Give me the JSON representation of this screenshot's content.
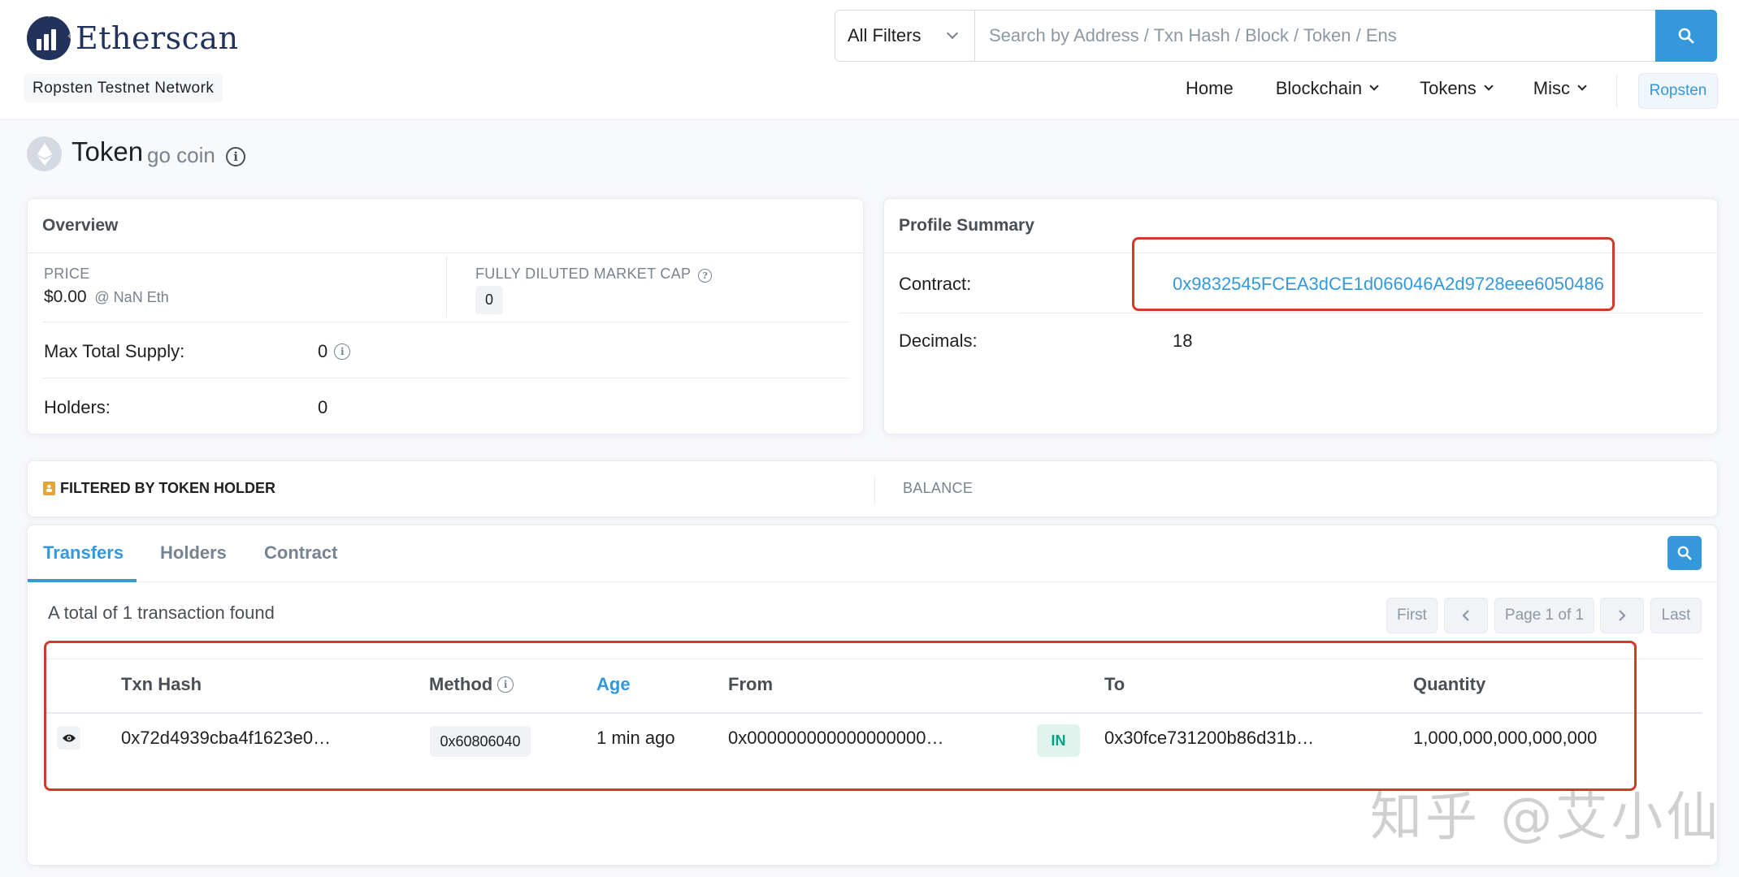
{
  "header": {
    "brand": "Etherscan",
    "network_badge": "Ropsten Testnet Network",
    "search": {
      "filter_label": "All Filters",
      "placeholder": "Search by Address / Txn Hash / Block / Token / Ens"
    },
    "nav": [
      "Home",
      "Blockchain",
      "Tokens",
      "Misc"
    ],
    "network_button": "Ropsten"
  },
  "page": {
    "title": "Token",
    "subtitle": "go coin"
  },
  "overview": {
    "header": "Overview",
    "price_label": "PRICE",
    "price_value": "$0.00",
    "price_eth": "@ NaN Eth",
    "market_cap_label": "FULLY DILUTED MARKET CAP",
    "market_cap_value": "0",
    "max_supply_label": "Max Total Supply:",
    "max_supply_value": "0",
    "holders_label": "Holders:",
    "holders_value": "0"
  },
  "profile": {
    "header": "Profile Summary",
    "contract_label": "Contract:",
    "contract_value": "0x9832545FCEA3dCE1d066046A2d9728eee6050486",
    "decimals_label": "Decimals:",
    "decimals_value": "18"
  },
  "filter_bar": {
    "label": "FILTERED BY TOKEN HOLDER",
    "balance_label": "BALANCE"
  },
  "tabs": [
    "Transfers",
    "Holders",
    "Contract"
  ],
  "transfers": {
    "summary": "A total of 1 transaction found",
    "pagination": {
      "first": "First",
      "page": "Page 1 of 1",
      "last": "Last"
    },
    "columns": [
      "Txn Hash",
      "Method",
      "Age",
      "From",
      "To",
      "Quantity"
    ],
    "rows": [
      {
        "txn_hash": "0x72d4939cba4f1623e0…",
        "method": "0x60806040",
        "age": "1 min ago",
        "from": "0x000000000000000000…",
        "direction": "IN",
        "to": "0x30fce731200b86d31b…",
        "quantity": "1,000,000,000,000,000"
      }
    ]
  },
  "watermark": "知乎 @艾小仙",
  "colors": {
    "link": "#3498db",
    "brand": "#21325b",
    "highlight": "#d03b28",
    "in_badge_bg": "#dff4ec",
    "in_badge_text": "#00a186"
  }
}
